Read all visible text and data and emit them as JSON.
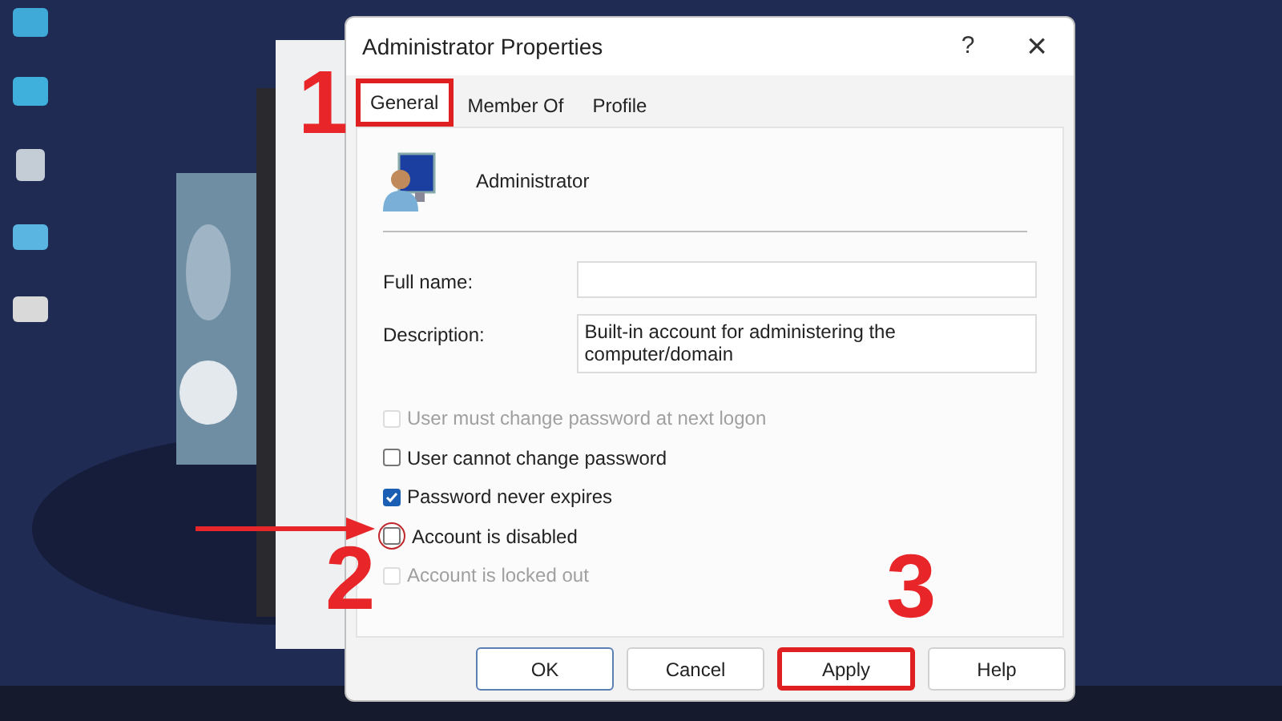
{
  "window": {
    "title": "Administrator Properties",
    "help": "?",
    "close": "×"
  },
  "tabs": [
    {
      "label": "General",
      "selected": true,
      "highlighted": true
    },
    {
      "label": "Member Of",
      "selected": false,
      "highlighted": false
    },
    {
      "label": "Profile",
      "selected": false,
      "highlighted": false
    }
  ],
  "user": {
    "name": "Administrator"
  },
  "fields": [
    {
      "label": "Full name:"
    },
    {
      "label": "Description:",
      "value": "Built-in account for administering the computer/domain"
    }
  ],
  "checkboxes": [
    {
      "label": "User must change password at next logon",
      "checked": false,
      "disabled": true,
      "circled": false
    },
    {
      "label": "User cannot change password",
      "checked": false,
      "disabled": false,
      "circled": false
    },
    {
      "label": "Password never expires",
      "checked": true,
      "disabled": false,
      "circled": false
    },
    {
      "label": "Account is disabled",
      "checked": false,
      "disabled": false,
      "circled": true
    },
    {
      "label": "Account is locked out",
      "checked": false,
      "disabled": true,
      "circled": false
    }
  ],
  "buttons": [
    {
      "label": "OK",
      "highlighted": false,
      "default": true
    },
    {
      "label": "Cancel",
      "highlighted": false,
      "default": false
    },
    {
      "label": "Apply",
      "highlighted": true,
      "default": false
    },
    {
      "label": "Help",
      "highlighted": false,
      "default": false
    }
  ],
  "annotations": [
    {
      "label": "1"
    },
    {
      "label": "2"
    },
    {
      "label": "3"
    }
  ]
}
